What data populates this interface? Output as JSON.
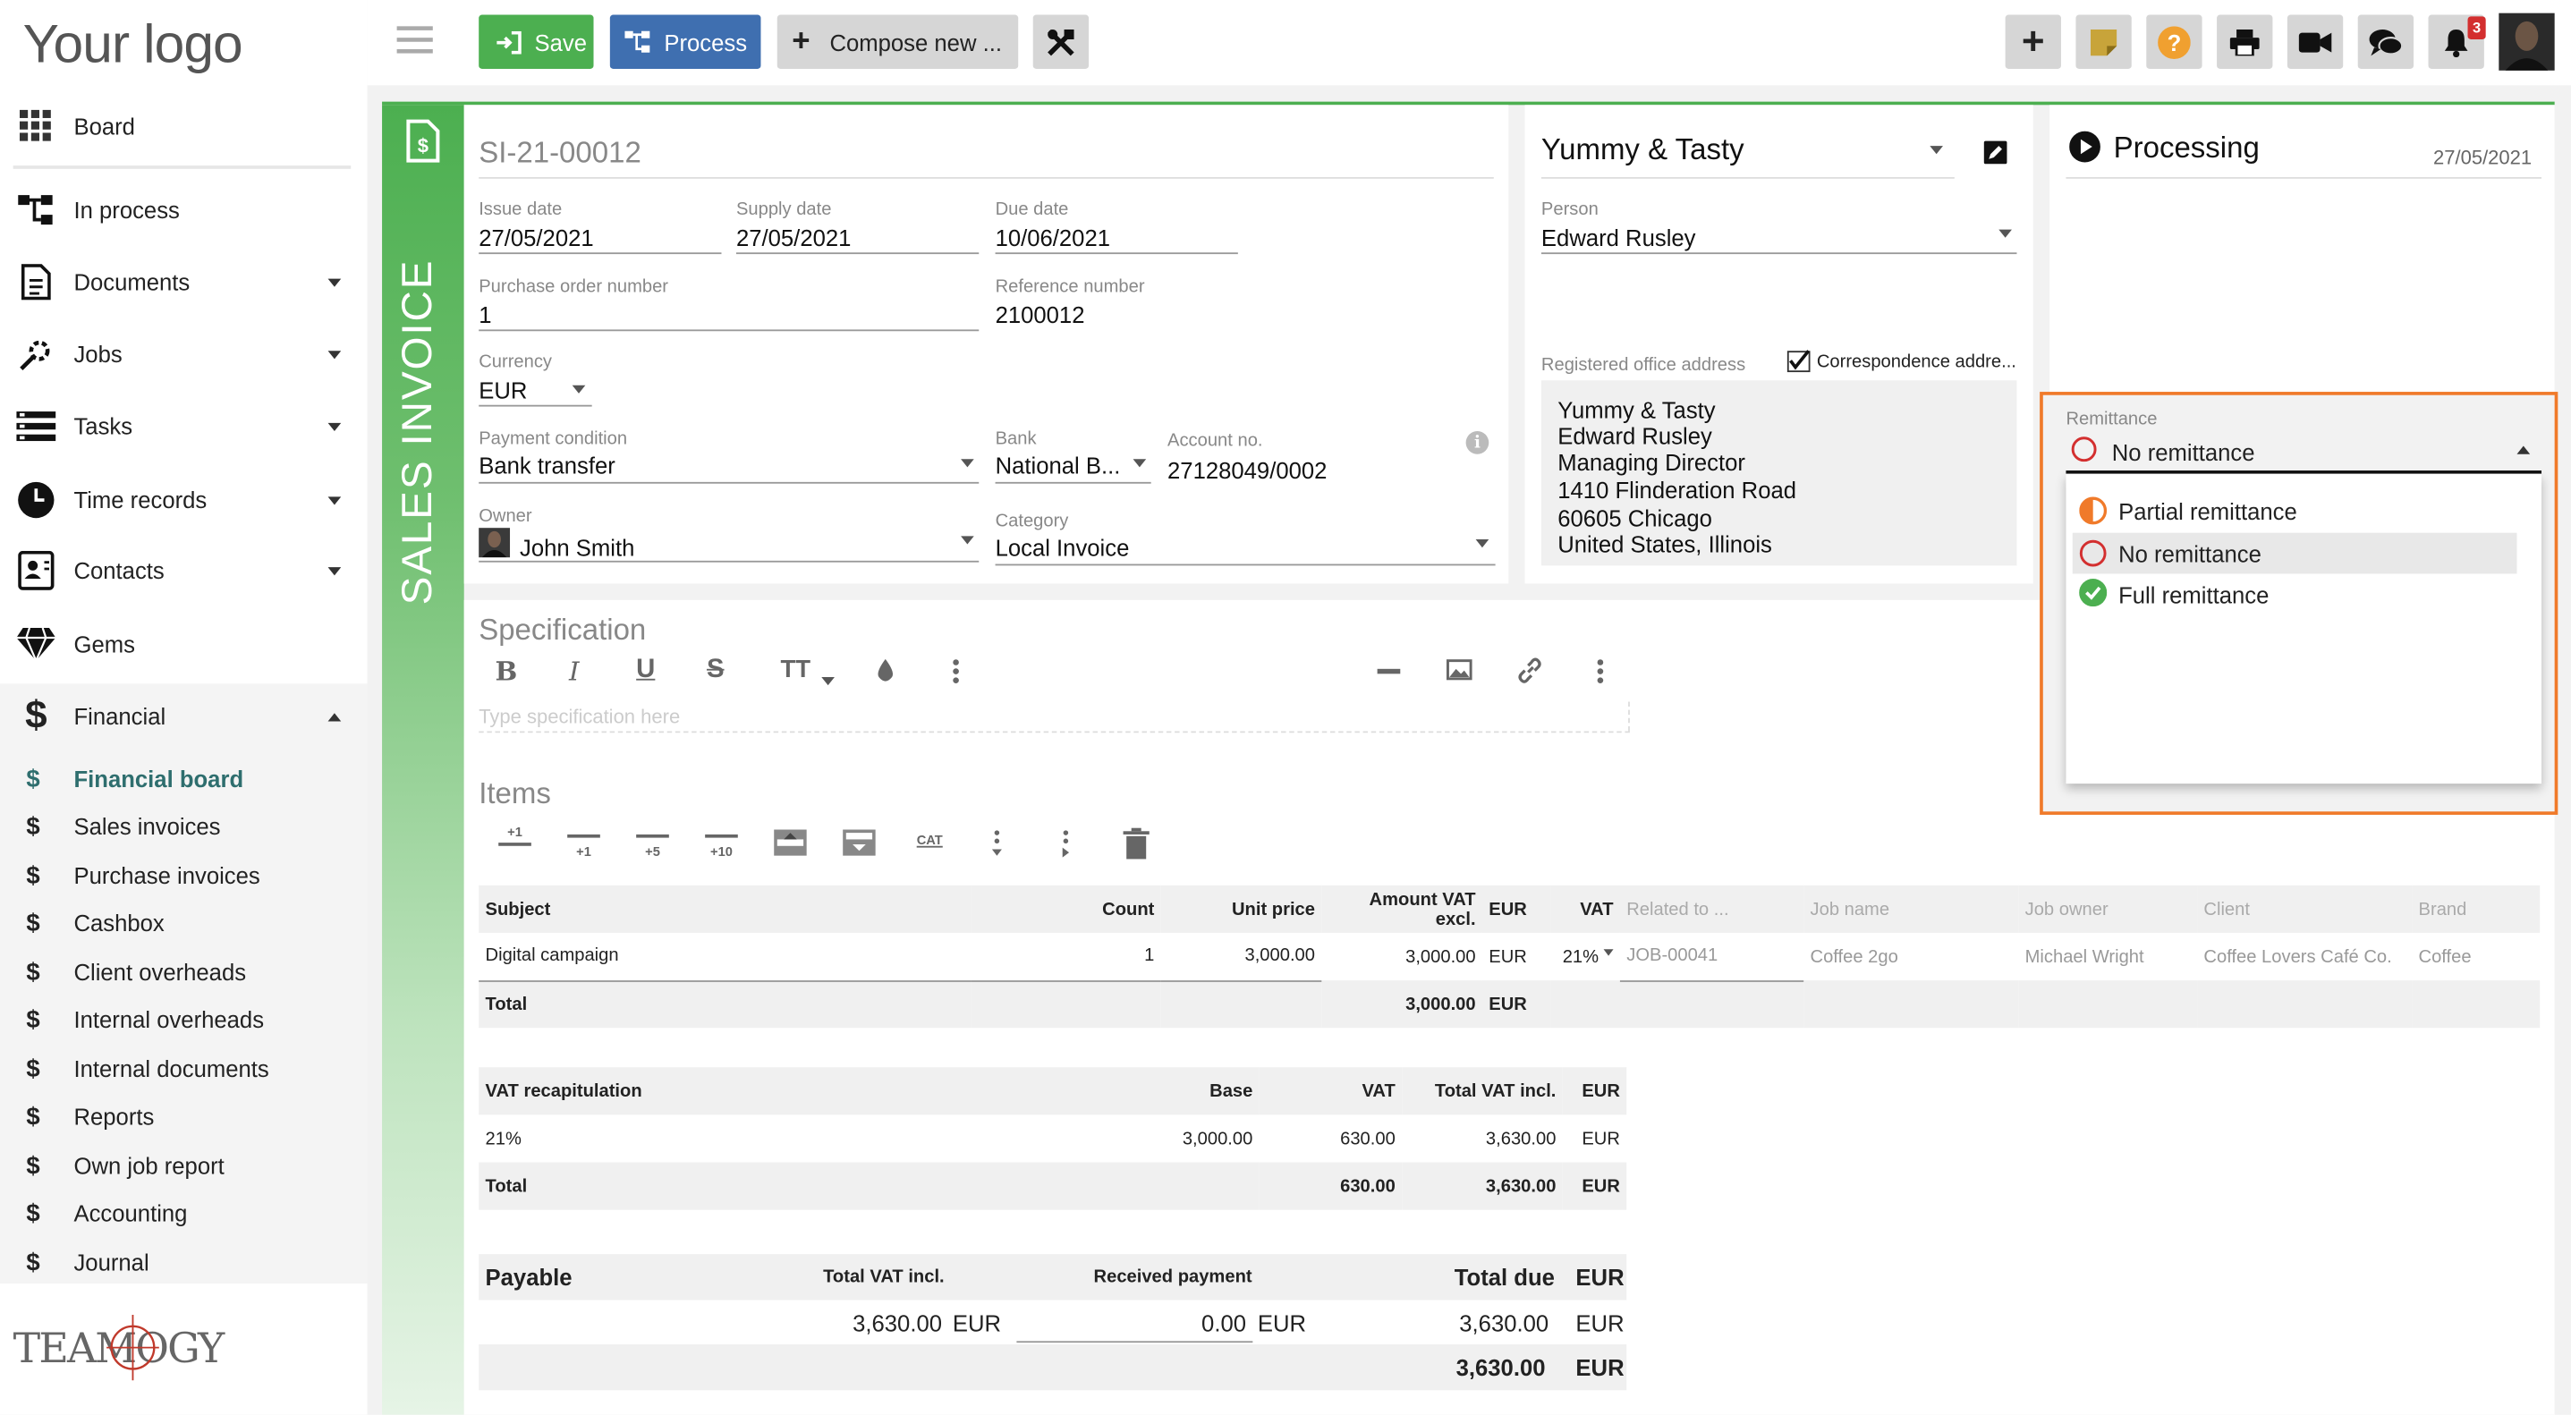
{
  "sidebar": {
    "logo": "Your logo",
    "items": [
      {
        "label": "Board",
        "icon": "grid-icon"
      },
      {
        "label": "In process",
        "icon": "flow-icon"
      },
      {
        "label": "Documents",
        "icon": "document-icon"
      },
      {
        "label": "Jobs",
        "icon": "jobs-icon"
      },
      {
        "label": "Tasks",
        "icon": "tasks-icon"
      },
      {
        "label": "Time records",
        "icon": "clock-icon"
      },
      {
        "label": "Contacts",
        "icon": "contact-card-icon"
      },
      {
        "label": "Gems",
        "icon": "gem-icon"
      },
      {
        "label": "Financial",
        "icon": "dollar-icon"
      }
    ],
    "financial_sub": [
      "Financial board",
      "Sales invoices",
      "Purchase invoices",
      "Cashbox",
      "Client overheads",
      "Internal overheads",
      "Internal documents",
      "Reports",
      "Own job report",
      "Accounting",
      "Journal"
    ],
    "footer_logo": "TEAMOGY"
  },
  "toolbar": {
    "save": "Save",
    "process": "Process",
    "compose": "Compose new ...",
    "notification_count": "3"
  },
  "invoice": {
    "side_title": "SALES INVOICE",
    "number": "SI-21-00012",
    "issue_date_label": "Issue date",
    "issue_date": "27/05/2021",
    "supply_date_label": "Supply date",
    "supply_date": "27/05/2021",
    "due_date_label": "Due date",
    "due_date": "10/06/2021",
    "po_label": "Purchase order number",
    "po": "1",
    "ref_label": "Reference number",
    "ref": "2100012",
    "currency_label": "Currency",
    "currency": "EUR",
    "payment_label": "Payment condition",
    "payment": "Bank transfer",
    "bank_label": "Bank",
    "bank": "National B...",
    "account_label": "Account no.",
    "account": "27128049/0002",
    "owner_label": "Owner",
    "owner": "John Smith",
    "category_label": "Category",
    "category": "Local Invoice"
  },
  "client": {
    "name": "Yummy & Tasty",
    "person_label": "Person",
    "person": "Edward Rusley",
    "address_label": "Registered office address",
    "correspondence_label": "Correspondence addre...",
    "address_lines": [
      "Yummy & Tasty",
      "Edward Rusley",
      "Managing Director",
      "1410 Flinderation Road",
      "60605 Chicago",
      "United States, Illinois"
    ]
  },
  "status": {
    "label": "Processing",
    "date": "27/05/2021",
    "remittance_label": "Remittance",
    "remittance_value": "No remittance",
    "options": [
      "Partial remittance",
      "No remittance",
      "Full remittance"
    ]
  },
  "specification": {
    "title": "Specification",
    "placeholder": "Type specification here"
  },
  "items": {
    "title": "Items",
    "tool_labels": [
      "+1",
      "+1",
      "+5",
      "+10",
      "CAT"
    ],
    "headers": [
      "Subject",
      "Count",
      "Unit price",
      "Amount VAT excl.",
      "EUR",
      "VAT",
      "Related to ...",
      "Job name",
      "Job owner",
      "Client",
      "Brand"
    ],
    "rows": [
      [
        "Digital campaign",
        "1",
        "3,000.00",
        "3,000.00",
        "EUR",
        "21%",
        "JOB-00041",
        "Coffee 2go",
        "Michael Wright",
        "Coffee Lovers Café Co.",
        "Coffee"
      ]
    ],
    "total_label": "Total",
    "total_amount": "3,000.00",
    "total_cur": "EUR"
  },
  "vat": {
    "headers": [
      "VAT recapitulation",
      "Base",
      "VAT",
      "Total VAT incl.",
      "EUR"
    ],
    "row": [
      "21%",
      "3,000.00",
      "630.00",
      "3,630.00",
      "EUR"
    ],
    "total": [
      "Total",
      "",
      "630.00",
      "3,630.00",
      "EUR"
    ]
  },
  "payable": {
    "title": "Payable",
    "total_vat_label": "Total VAT incl.",
    "received_label": "Received payment",
    "total_due_label": "Total due",
    "cur": "EUR",
    "total_vat": "3,630.00",
    "received": "0.00",
    "total_due": "3,630.00",
    "grand_total": "3,630.00"
  },
  "colors": {
    "green": "#4caf50",
    "blue": "#3f6fb0",
    "orange": "#f07a2a",
    "teal": "#2e6e6e"
  }
}
